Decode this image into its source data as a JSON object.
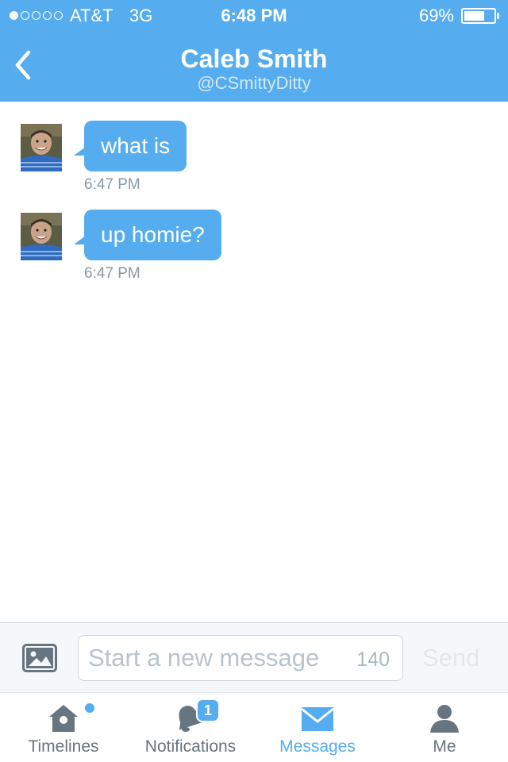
{
  "status_bar": {
    "signal_bars_filled": 1,
    "signal_bars_total": 5,
    "carrier": "AT&T",
    "network": "3G",
    "time": "6:48 PM",
    "battery_percent": "69%",
    "battery_level": 0.69
  },
  "header": {
    "back_icon": "chevron-left-icon",
    "title": "Caleb Smith",
    "subtitle": "@CSmittyDitty"
  },
  "messages": [
    {
      "text": "what is",
      "time": "6:47 PM"
    },
    {
      "text": "up homie?",
      "time": "6:47 PM"
    }
  ],
  "composer": {
    "photo_icon": "image-icon",
    "placeholder": "Start a new message",
    "value": "",
    "char_count": "140",
    "send_label": "Send"
  },
  "tabs": [
    {
      "label": "Timelines",
      "icon": "home-icon",
      "active": false,
      "new_dot": true
    },
    {
      "label": "Notifications",
      "icon": "bell-icon",
      "active": false,
      "badge": "1"
    },
    {
      "label": "Messages",
      "icon": "envelope-icon",
      "active": true
    },
    {
      "label": "Me",
      "icon": "person-icon",
      "active": false
    }
  ],
  "colors": {
    "accent": "#55acee",
    "muted": "#66757f",
    "timestamp": "#8899a6"
  }
}
